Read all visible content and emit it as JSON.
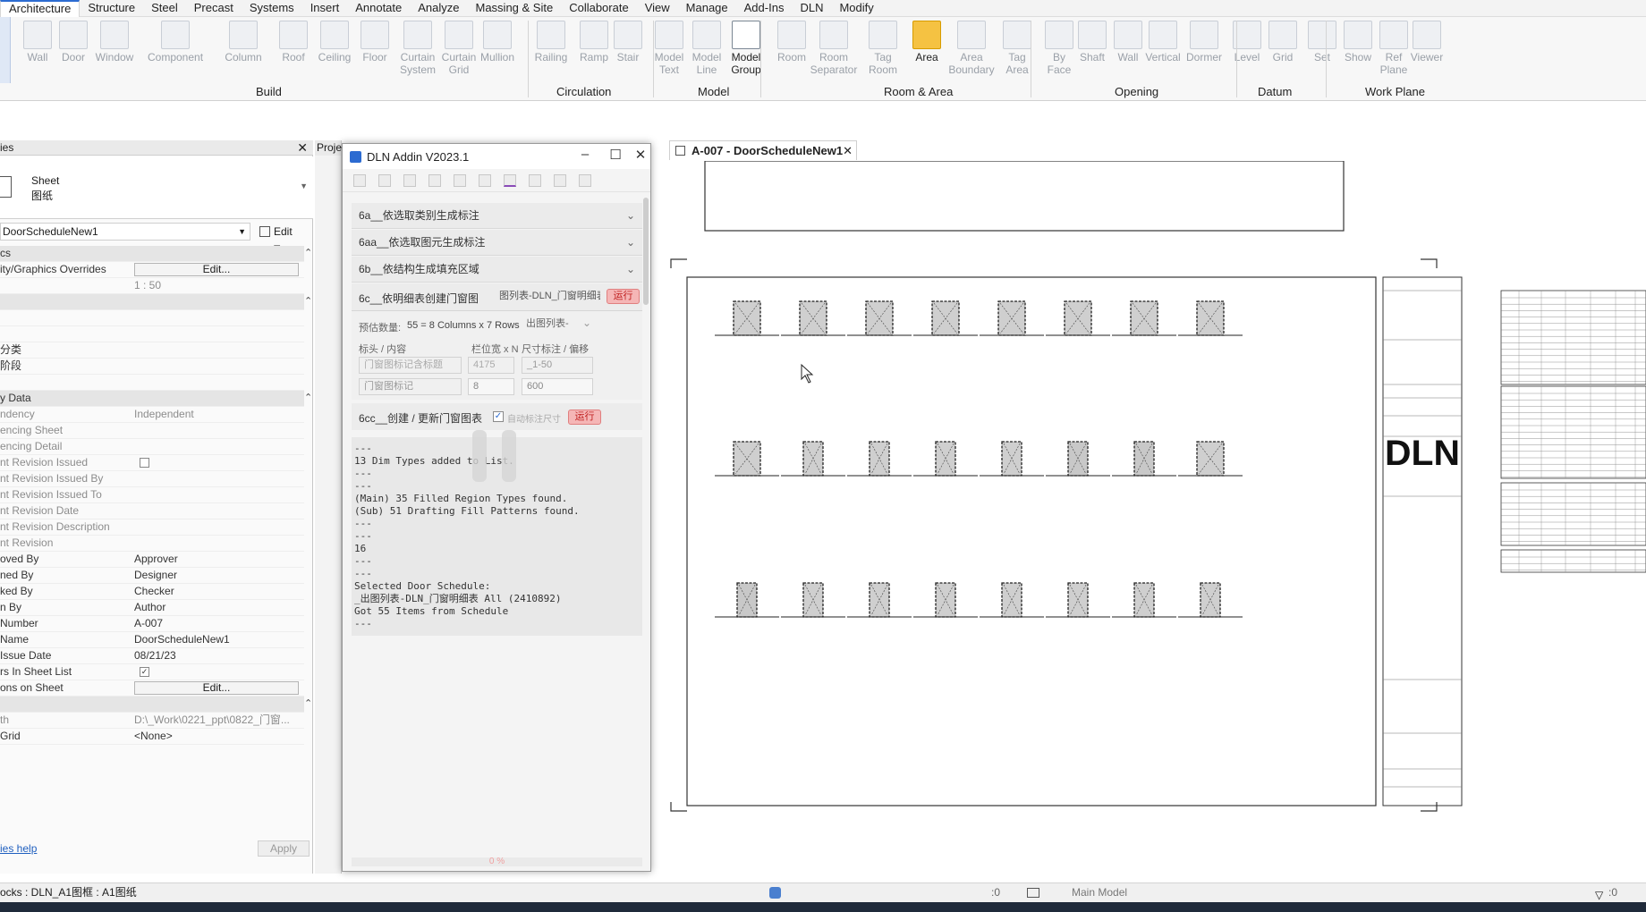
{
  "menubar": {
    "tabs": [
      "Architecture",
      "Structure",
      "Steel",
      "Precast",
      "Systems",
      "Insert",
      "Annotate",
      "Analyze",
      "Massing & Site",
      "Collaborate",
      "View",
      "Manage",
      "Add-Ins",
      "DLN",
      "Modify"
    ],
    "active": "Architecture"
  },
  "ribbon": {
    "tools": [
      {
        "label": "Wall",
        "sub": ""
      },
      {
        "label": "Door",
        "sub": ""
      },
      {
        "label": "Window",
        "sub": ""
      },
      {
        "label": "Component",
        "sub": ""
      },
      {
        "label": "Column",
        "sub": ""
      },
      {
        "label": "Roof",
        "sub": ""
      },
      {
        "label": "Ceiling",
        "sub": ""
      },
      {
        "label": "Floor",
        "sub": ""
      },
      {
        "label": "Curtain",
        "sub": "System"
      },
      {
        "label": "Curtain",
        "sub": "Grid"
      },
      {
        "label": "Mullion",
        "sub": ""
      },
      {
        "label": "Railing",
        "sub": ""
      },
      {
        "label": "Ramp",
        "sub": ""
      },
      {
        "label": "Stair",
        "sub": ""
      },
      {
        "label": "Model",
        "sub": "Text"
      },
      {
        "label": "Model",
        "sub": "Line"
      },
      {
        "label": "Model",
        "sub": "Group"
      },
      {
        "label": "Room",
        "sub": ""
      },
      {
        "label": "Room",
        "sub": "Separator"
      },
      {
        "label": "Tag",
        "sub": "Room"
      },
      {
        "label": "Area",
        "sub": ""
      },
      {
        "label": "Area",
        "sub": "Boundary"
      },
      {
        "label": "Tag",
        "sub": "Area"
      },
      {
        "label": "By",
        "sub": "Face"
      },
      {
        "label": "Shaft",
        "sub": ""
      },
      {
        "label": "Wall",
        "sub": ""
      },
      {
        "label": "Vertical",
        "sub": ""
      },
      {
        "label": "Dormer",
        "sub": ""
      },
      {
        "label": "Level",
        "sub": ""
      },
      {
        "label": "Grid",
        "sub": ""
      },
      {
        "label": "Set",
        "sub": ""
      },
      {
        "label": "Show",
        "sub": ""
      },
      {
        "label": "Ref",
        "sub": "Plane"
      },
      {
        "label": "Viewer",
        "sub": ""
      }
    ],
    "panels": [
      "Build",
      "Circulation",
      "Model",
      "Room & Area",
      "Opening",
      "Datum",
      "Work Plane"
    ]
  },
  "properties": {
    "header": "ies",
    "type_name": "Sheet",
    "type_sub": "图纸",
    "instance_select": "DoorScheduleNew1",
    "edit_type": "Edit Type",
    "rows": [
      {
        "k": "cs",
        "v": "",
        "group": true
      },
      {
        "k": "ity/Graphics Overrides",
        "v": "Edit...",
        "btn": true
      },
      {
        "k": "",
        "v": "1 : 50",
        "dim": true
      },
      {
        "k": "",
        "v": "",
        "group": true
      },
      {
        "k": "",
        "v": ""
      },
      {
        "k": "",
        "v": ""
      },
      {
        "k": "分类",
        "v": ""
      },
      {
        "k": "阶段",
        "v": ""
      },
      {
        "k": "",
        "v": ""
      },
      {
        "k": "y Data",
        "v": "",
        "group": true
      },
      {
        "k": "ndency",
        "v": "Independent",
        "dim": true
      },
      {
        "k": "encing Sheet",
        "v": "",
        "dim": true
      },
      {
        "k": "encing Detail",
        "v": "",
        "dim": true
      },
      {
        "k": "nt Revision Issued",
        "v": "",
        "dim": true,
        "check": true
      },
      {
        "k": "nt Revision Issued By",
        "v": "",
        "dim": true
      },
      {
        "k": "nt Revision Issued To",
        "v": "",
        "dim": true
      },
      {
        "k": "nt Revision Date",
        "v": "",
        "dim": true
      },
      {
        "k": "nt Revision Description",
        "v": "",
        "dim": true
      },
      {
        "k": "nt Revision",
        "v": "",
        "dim": true
      },
      {
        "k": "oved By",
        "v": "Approver"
      },
      {
        "k": "ned By",
        "v": "Designer"
      },
      {
        "k": "ked By",
        "v": "Checker"
      },
      {
        "k": "n By",
        "v": "Author"
      },
      {
        "k": "Number",
        "v": "A-007"
      },
      {
        "k": "Name",
        "v": "DoorScheduleNew1"
      },
      {
        "k": "Issue Date",
        "v": "08/21/23"
      },
      {
        "k": "rs In Sheet List",
        "v": "",
        "check": true,
        "checked": true
      },
      {
        "k": "ons on Sheet",
        "v": "Edit...",
        "btn": true
      },
      {
        "k": "",
        "v": "",
        "group": true
      },
      {
        "k": "th",
        "v": "D:\\_Work\\0221_ppt\\0822_门窗...",
        "dim": true
      },
      {
        "k": "Grid",
        "v": "<None>"
      }
    ],
    "help_link": "ies help",
    "apply": "Apply"
  },
  "project_browser": {
    "header": "Proje"
  },
  "dialog": {
    "title": "DLN Addin V2023.1",
    "sections": [
      {
        "label": "6a__依选取类别生成标注"
      },
      {
        "label": "6aa__依选取图元生成标注"
      },
      {
        "label": "6b__依结构生成填充区域"
      }
    ],
    "s6c": {
      "label": "6c__依明细表创建门窗图",
      "schedule": "图列表-DLN_门窗明细表",
      "run": "运行",
      "estimate_label": "预估数量:",
      "estimate_value": "55 = 8 Columns x 7 Rows",
      "dropdown_out": "出图列表-",
      "col1_head": "标头 / 内容",
      "col2_head": "栏位宽 x N",
      "col3_head": "尺寸标注 / 偏移",
      "r1_select": "门窗图标记含标题",
      "r1_width": "4175",
      "r1_dim": "_1-50",
      "r2_select": "门窗图标记",
      "r2_n": "8",
      "r2_offset": "600"
    },
    "s6cc": {
      "label": "6cc__创建 / 更新门窗图表",
      "auto_dim": "自动标注尺寸",
      "run": "运行"
    },
    "log": "---\n13 Dim Types added to List.\n---\n---\n(Main) 35 Filled Region Types found.\n(Sub) 51 Drafting Fill Patterns found.\n---\n---\n16\n---\n---\nSelected Door Schedule:\n_出图列表-DLN_门窗明细表 All (2410892)\nGot 55 Items from Schedule\n---",
    "progress": "0 %"
  },
  "view": {
    "tab_title": "A-007 - DoorScheduleNew1",
    "title_block_logo": "DLN"
  },
  "statusbar": {
    "left": "ocks : DLN_A1图框 : A1图纸",
    "zero1": ":0",
    "model": "Main Model",
    "zero2": ":0"
  },
  "colors": {
    "accent": "#2c6bd1",
    "run": "#f5b6b6",
    "highlight": "#f5c242"
  }
}
